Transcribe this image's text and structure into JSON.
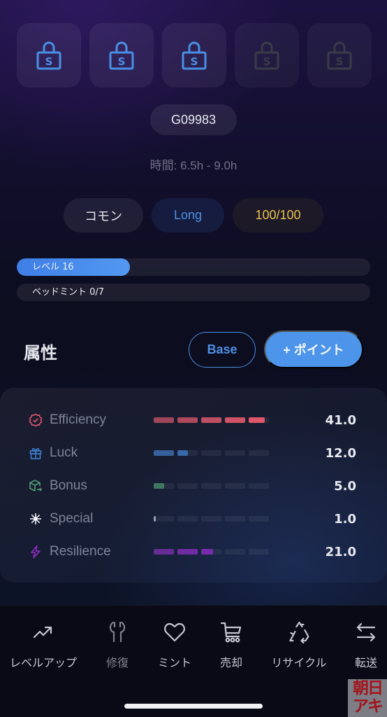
{
  "slots": [
    {
      "icon": "lock-s-icon",
      "state": "unlocked",
      "letter": "S"
    },
    {
      "icon": "lock-s-icon",
      "state": "unlocked",
      "letter": "S"
    },
    {
      "icon": "lock-s-icon",
      "state": "unlocked",
      "letter": "S"
    },
    {
      "icon": "lock-s-icon",
      "state": "locked",
      "letter": "S"
    },
    {
      "icon": "lock-s-icon",
      "state": "locked",
      "letter": "S"
    }
  ],
  "item_id": "G09983",
  "time_range": "時間: 6.5h - 9.0h",
  "chips": {
    "rarity": "コモン",
    "type": "Long",
    "durability": "100/100"
  },
  "level_bar": {
    "label": "レベル 16",
    "progress": 0.32
  },
  "mint_bar": {
    "label": "ベッドミント 0/7",
    "progress": 0
  },
  "attributes": {
    "title": "属性",
    "base_button": "Base",
    "point_button": "+ ポイント",
    "stats": [
      {
        "name": "Efficiency",
        "icon": "badge-check-icon",
        "value": "41.0",
        "fill_fraction": 0.96,
        "color": "#e0566a"
      },
      {
        "name": "Luck",
        "icon": "gift-icon",
        "value": "12.0",
        "fill_fraction": 0.3,
        "color": "#3f7fcf"
      },
      {
        "name": "Bonus",
        "icon": "box-arrow-icon",
        "value": "5.0",
        "fill_fraction": 0.1,
        "color": "#4f9f75"
      },
      {
        "name": "Special",
        "icon": "sparkle-icon",
        "value": "1.0",
        "fill_fraction": 0.02,
        "color": "#d7dae4"
      },
      {
        "name": "Resilience",
        "icon": "lightning-icon",
        "value": "21.0",
        "fill_fraction": 0.52,
        "color": "#8a2cc0"
      }
    ]
  },
  "bottom_nav": [
    {
      "label": "レベルアップ",
      "icon": "trending-up-icon",
      "enabled": true
    },
    {
      "label": "修復",
      "icon": "wrench-icon",
      "enabled": false
    },
    {
      "label": "ミント",
      "icon": "heart-icon",
      "enabled": true
    },
    {
      "label": "売却",
      "icon": "cart-icon",
      "enabled": true
    },
    {
      "label": "リサイクル",
      "icon": "recycle-icon",
      "enabled": true
    },
    {
      "label": "転送",
      "icon": "transfer-arrows-icon",
      "enabled": true
    }
  ],
  "watermark": "朝日アキ",
  "colors": {
    "accent": "#4d95ea",
    "lock_active": "#4a8fe6",
    "lock_inactive": "#3a3b48",
    "durability": "#e8c250"
  }
}
